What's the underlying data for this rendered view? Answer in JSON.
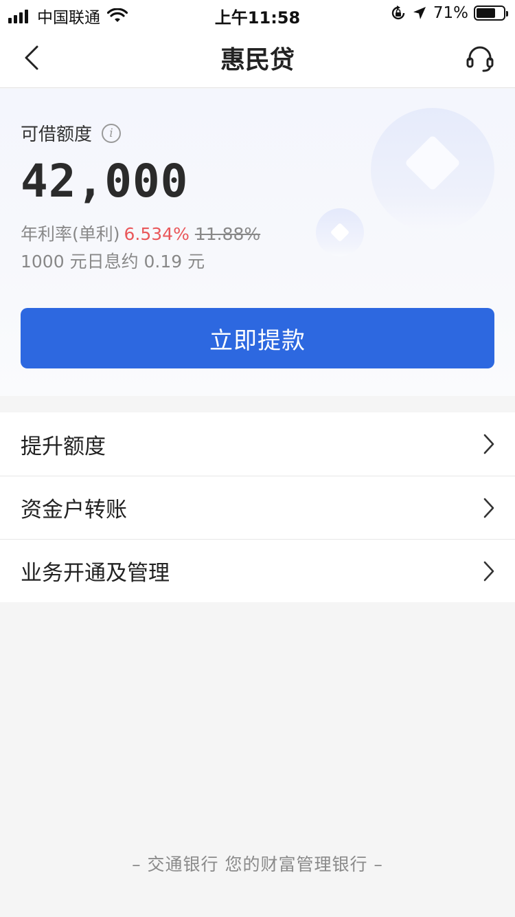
{
  "status_bar": {
    "carrier": "中国联通",
    "time": "上午11:58",
    "battery": "71%",
    "battery_level": 0.71,
    "icons": [
      "signal-icon",
      "wifi-icon",
      "orientation-lock-icon",
      "location-icon",
      "battery-icon"
    ]
  },
  "nav": {
    "title": "惠民贷",
    "back_icon": "chevron-left-icon",
    "service_icon": "headset-icon"
  },
  "loan": {
    "limit_label": "可借额度",
    "limit_amount": "42,000",
    "rate_label": "年利率(单利)",
    "rate_current": "6.534%",
    "rate_original": "11.88%",
    "interest_text": "1000 元日息约 0.19 元",
    "withdraw_label": "立即提款"
  },
  "menu": {
    "items": [
      {
        "label": "提升额度"
      },
      {
        "label": "资金户转账"
      },
      {
        "label": "业务开通及管理"
      }
    ]
  },
  "footer": "– 交通银行 您的财富管理银行 –",
  "colors": {
    "primary": "#2d68e0",
    "rate_highlight": "#e9575a",
    "background": "#f5f5f5"
  }
}
